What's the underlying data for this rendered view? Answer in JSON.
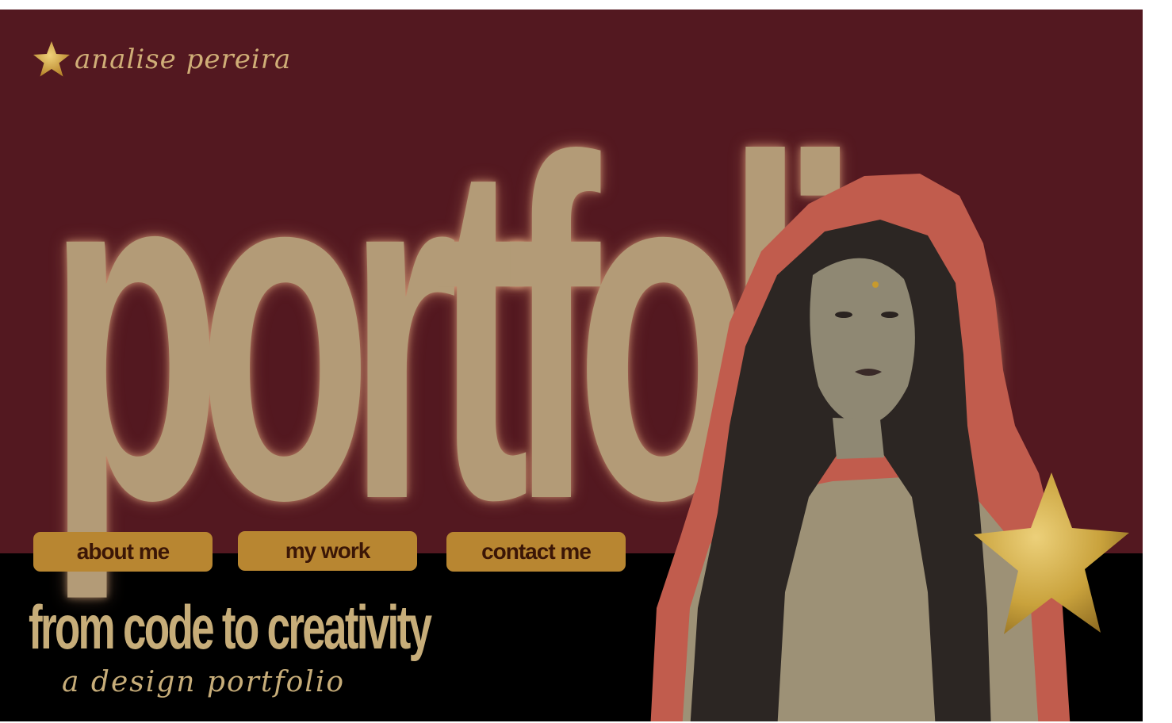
{
  "brand": {
    "name": "analise pereira",
    "icon": "star-icon",
    "accent": "#d4a838"
  },
  "hero": {
    "title": "portfolio",
    "title_color": "#b39b77",
    "background": "#531820"
  },
  "nav": {
    "items": [
      {
        "label": "about me"
      },
      {
        "label": "my work"
      },
      {
        "label": "contact me"
      }
    ],
    "button_color": "#b88631",
    "text_color": "#3b1606"
  },
  "tagline": {
    "main": "from code to creativity",
    "sub": "a design portfolio",
    "color": "#c7ad79"
  },
  "decor": {
    "portrait_outline": "#c15c4d",
    "star_color": "#c9a23c",
    "lower_background": "#000000"
  }
}
